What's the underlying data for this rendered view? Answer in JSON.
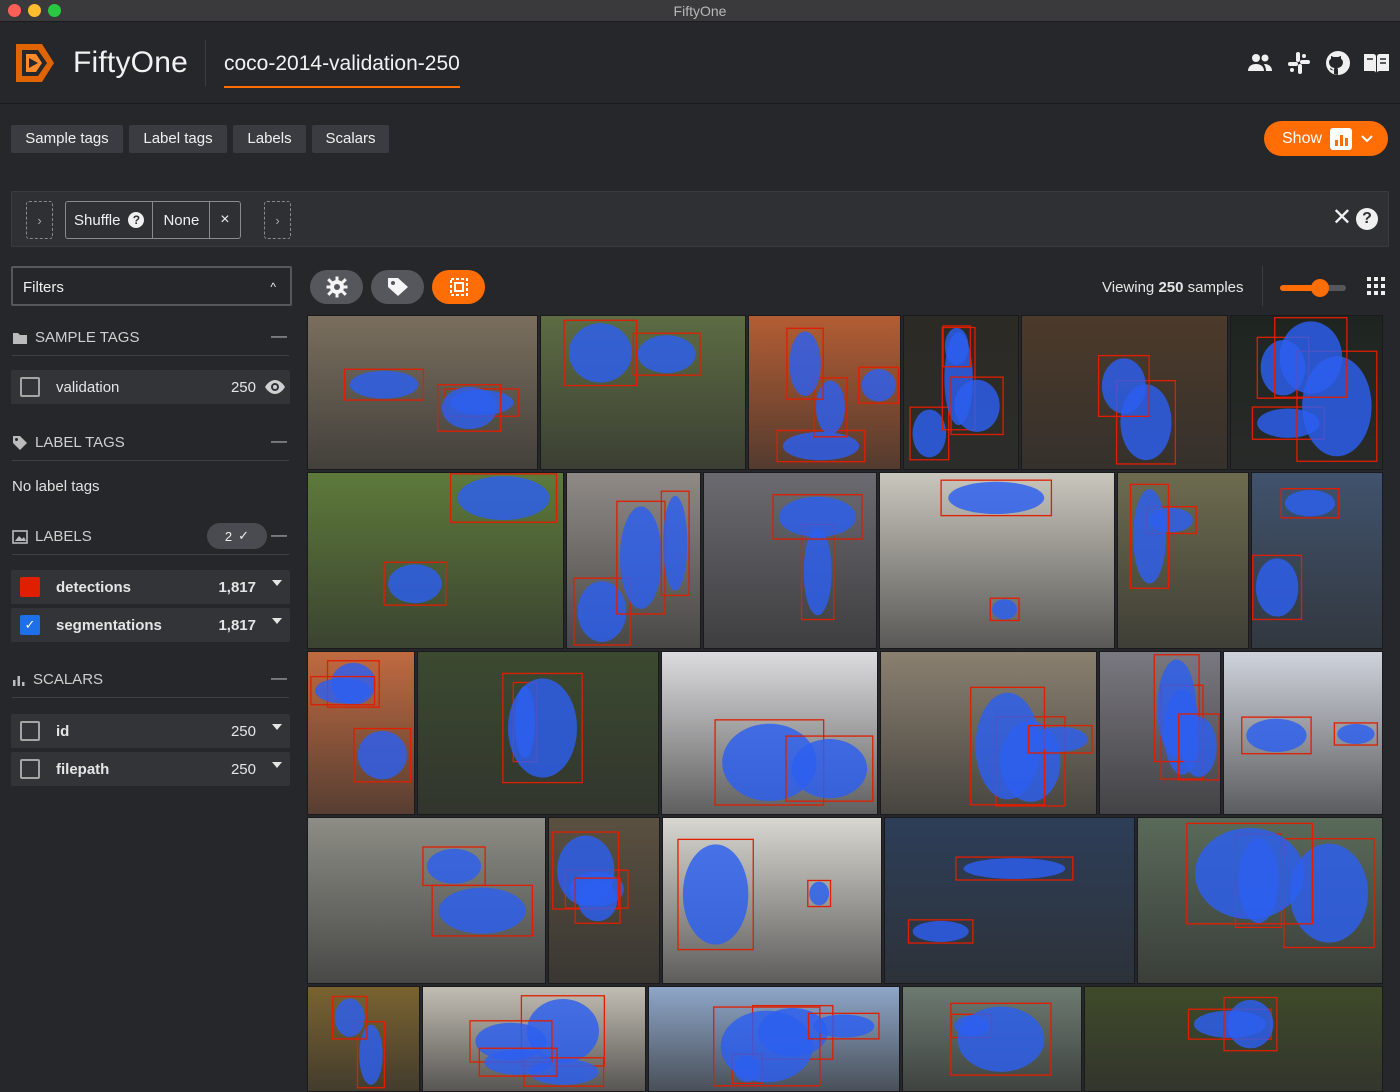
{
  "window": {
    "title": "FiftyOne"
  },
  "header": {
    "brand": "FiftyOne",
    "dataset_name": "coco-2014-validation-250",
    "icons": [
      "team-icon",
      "slack-icon",
      "github-icon",
      "docs-book-icon"
    ]
  },
  "tabs": {
    "items": [
      {
        "label": "Sample tags"
      },
      {
        "label": "Label tags"
      },
      {
        "label": "Labels"
      },
      {
        "label": "Scalars"
      }
    ],
    "show_button": {
      "label": "Show",
      "icon": "bar-chart-icon"
    }
  },
  "view_bar": {
    "stage": {
      "name": "Shuffle",
      "value": "None"
    }
  },
  "sidebar": {
    "filters_label": "Filters",
    "sample_tags": {
      "title": "SAMPLE TAGS",
      "items": [
        {
          "label": "validation",
          "count": "250"
        }
      ]
    },
    "label_tags": {
      "title": "LABEL TAGS",
      "empty_text": "No label tags"
    },
    "labels": {
      "title": "LABELS",
      "selected_count": "2",
      "items": [
        {
          "label": "detections",
          "count": "1,817",
          "color": "#e01e00",
          "checked": true
        },
        {
          "label": "segmentations",
          "count": "1,817",
          "color": "#1e6fea",
          "checked": true
        }
      ]
    },
    "scalars": {
      "title": "SCALARS",
      "items": [
        {
          "label": "id",
          "count": "250"
        },
        {
          "label": "filepath",
          "count": "250"
        }
      ]
    }
  },
  "grid_toolbar": {
    "viewing_prefix": "Viewing",
    "viewing_count": "250",
    "viewing_suffix": "samples",
    "zoom_level": 0.5
  },
  "colors": {
    "accent": "#ff6d04",
    "detection_box": "#e01e00",
    "segmentation_mask": "#2c5ff0"
  },
  "samples": [
    {
      "scene": "bus street",
      "bg": "#7a6f5e"
    },
    {
      "scene": "park bench",
      "bg": "#5d6c43"
    },
    {
      "scene": "tennis player clay court",
      "bg": "#b35d33"
    },
    {
      "scene": "night alley",
      "bg": "#2b2a24"
    },
    {
      "scene": "pizza table",
      "bg": "#4c3a2a"
    },
    {
      "scene": "night street",
      "bg": "#1e2520"
    },
    {
      "scene": "frisbee park",
      "bg": "#5d7a3a"
    },
    {
      "scene": "reading book beach",
      "bg": "#8f8a86"
    },
    {
      "scene": "baby with dog",
      "bg": "#6a6a70"
    },
    {
      "scene": "dinner plate",
      "bg": "#c9c6bd"
    },
    {
      "scene": "car under bridge",
      "bg": "#6d6b4e"
    },
    {
      "scene": "cat close up",
      "bg": "#40536d"
    },
    {
      "scene": "tennis player",
      "bg": "#c06a40"
    },
    {
      "scene": "tram bus",
      "bg": "#3c4a30"
    },
    {
      "scene": "ski slope",
      "bg": "#dcdcde"
    },
    {
      "scene": "giraffes indoor",
      "bg": "#8a8070"
    },
    {
      "scene": "person in dress",
      "bg": "#7a7880"
    },
    {
      "scene": "snowy forest skier",
      "bg": "#cfd3db"
    },
    {
      "scene": "kite street",
      "bg": "#8d8d86"
    },
    {
      "scene": "elephants",
      "bg": "#5a5040"
    },
    {
      "scene": "flags sky",
      "bg": "#d8d6d0"
    },
    {
      "scene": "tennis jp morgan",
      "bg": "#2d3e58"
    },
    {
      "scene": "motorcycle race",
      "bg": "#5a6a5a"
    },
    {
      "scene": "blender kitchen",
      "bg": "#7a6330"
    },
    {
      "scene": "kitchen interior",
      "bg": "#c2bdb3"
    },
    {
      "scene": "airplane sky",
      "bg": "#8ea6c8"
    },
    {
      "scene": "building facade",
      "bg": "#6c7a70"
    },
    {
      "scene": "cat in grass",
      "bg": "#3f4a2a"
    }
  ]
}
